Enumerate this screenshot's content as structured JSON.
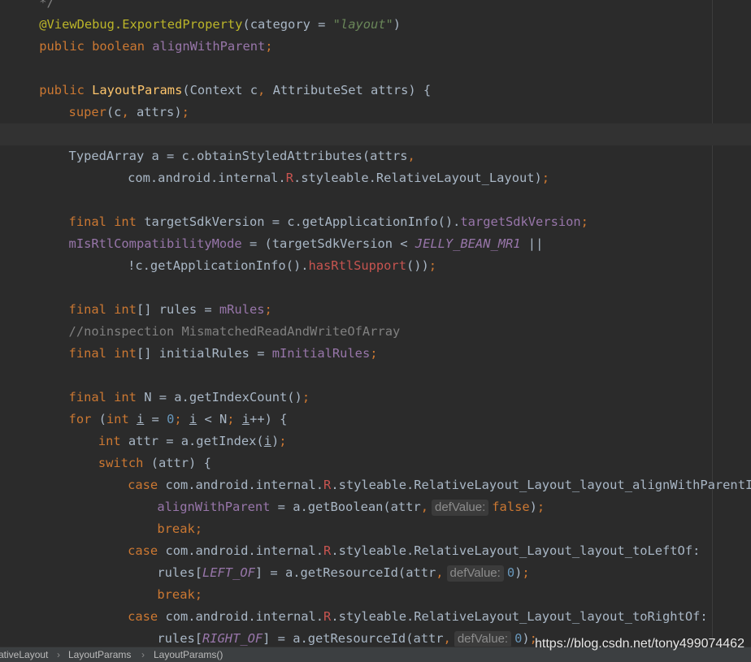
{
  "editor": {
    "lines": [
      {
        "indent": 4,
        "tokens": [
          {
            "t": "*/",
            "c": "cmt"
          }
        ]
      },
      {
        "indent": 4,
        "tokens": [
          {
            "t": "@ViewDebug.ExportedProperty",
            "c": "ann"
          },
          {
            "t": "(category = ",
            "c": "plain"
          },
          {
            "t": "\"layout\"",
            "c": "str"
          },
          {
            "t": ")",
            "c": "plain"
          }
        ]
      },
      {
        "indent": 4,
        "tokens": [
          {
            "t": "public boolean ",
            "c": "kw"
          },
          {
            "t": "alignWithParent",
            "c": "field"
          },
          {
            "t": ";",
            "c": "kw"
          }
        ]
      },
      {
        "indent": 0,
        "tokens": []
      },
      {
        "indent": 4,
        "tokens": [
          {
            "t": "public ",
            "c": "kw"
          },
          {
            "t": "LayoutParams",
            "c": "method"
          },
          {
            "t": "(Context c",
            "c": "plain"
          },
          {
            "t": ", ",
            "c": "kw"
          },
          {
            "t": "AttributeSet attrs) {",
            "c": "plain"
          }
        ]
      },
      {
        "indent": 8,
        "tokens": [
          {
            "t": "super",
            "c": "kw"
          },
          {
            "t": "(c",
            "c": "plain"
          },
          {
            "t": ", ",
            "c": "kw"
          },
          {
            "t": "attrs)",
            "c": "plain"
          },
          {
            "t": ";",
            "c": "kw"
          }
        ]
      },
      {
        "indent": 0,
        "tokens": [],
        "caret": true
      },
      {
        "indent": 8,
        "tokens": [
          {
            "t": "TypedArray a = c.obtainStyledAttributes(attrs",
            "c": "plain"
          },
          {
            "t": ",",
            "c": "kw"
          }
        ]
      },
      {
        "indent": 16,
        "tokens": [
          {
            "t": "com.android.internal.",
            "c": "plain"
          },
          {
            "t": "R",
            "c": "r"
          },
          {
            "t": ".styleable.RelativeLayout_Layout)",
            "c": "plain"
          },
          {
            "t": ";",
            "c": "kw"
          }
        ]
      },
      {
        "indent": 0,
        "tokens": []
      },
      {
        "indent": 8,
        "tokens": [
          {
            "t": "final int ",
            "c": "kw"
          },
          {
            "t": "targetSdkVersion = c.getApplicationInfo().",
            "c": "plain"
          },
          {
            "t": "targetSdkVersion",
            "c": "field"
          },
          {
            "t": ";",
            "c": "kw"
          }
        ]
      },
      {
        "indent": 8,
        "tokens": [
          {
            "t": "mIsRtlCompatibilityMode",
            "c": "field"
          },
          {
            "t": " = (targetSdkVersion < ",
            "c": "plain"
          },
          {
            "t": "JELLY_BEAN_MR1",
            "c": "const"
          },
          {
            "t": " ||",
            "c": "plain"
          }
        ]
      },
      {
        "indent": 16,
        "tokens": [
          {
            "t": "!c.getApplicationInfo().",
            "c": "plain"
          },
          {
            "t": "hasRtlSupport",
            "c": "r"
          },
          {
            "t": "())",
            "c": "plain"
          },
          {
            "t": ";",
            "c": "kw"
          }
        ]
      },
      {
        "indent": 0,
        "tokens": []
      },
      {
        "indent": 8,
        "tokens": [
          {
            "t": "final int",
            "c": "kw"
          },
          {
            "t": "[] rules = ",
            "c": "plain"
          },
          {
            "t": "mRules",
            "c": "field"
          },
          {
            "t": ";",
            "c": "kw"
          }
        ]
      },
      {
        "indent": 8,
        "tokens": [
          {
            "t": "//noinspection MismatchedReadAndWriteOfArray",
            "c": "cmt"
          }
        ]
      },
      {
        "indent": 8,
        "tokens": [
          {
            "t": "final int",
            "c": "kw"
          },
          {
            "t": "[] initialRules = ",
            "c": "plain"
          },
          {
            "t": "mInitialRules",
            "c": "field"
          },
          {
            "t": ";",
            "c": "kw"
          }
        ]
      },
      {
        "indent": 0,
        "tokens": []
      },
      {
        "indent": 8,
        "tokens": [
          {
            "t": "final int ",
            "c": "kw"
          },
          {
            "t": "N = a.getIndexCount()",
            "c": "plain"
          },
          {
            "t": ";",
            "c": "kw"
          }
        ]
      },
      {
        "indent": 8,
        "tokens": [
          {
            "t": "for ",
            "c": "kw"
          },
          {
            "t": "(",
            "c": "plain"
          },
          {
            "t": "int ",
            "c": "kw"
          },
          {
            "t": "i",
            "c": "u"
          },
          {
            "t": " = ",
            "c": "plain"
          },
          {
            "t": "0",
            "c": "num"
          },
          {
            "t": "; ",
            "c": "kw"
          },
          {
            "t": "i",
            "c": "u"
          },
          {
            "t": " < N",
            "c": "plain"
          },
          {
            "t": "; ",
            "c": "kw"
          },
          {
            "t": "i",
            "c": "u"
          },
          {
            "t": "++) {",
            "c": "plain"
          }
        ]
      },
      {
        "indent": 12,
        "tokens": [
          {
            "t": "int ",
            "c": "kw"
          },
          {
            "t": "attr = a.getIndex(",
            "c": "plain"
          },
          {
            "t": "i",
            "c": "u"
          },
          {
            "t": ")",
            "c": "plain"
          },
          {
            "t": ";",
            "c": "kw"
          }
        ]
      },
      {
        "indent": 12,
        "tokens": [
          {
            "t": "switch ",
            "c": "kw"
          },
          {
            "t": "(attr) {",
            "c": "plain"
          }
        ]
      },
      {
        "indent": 16,
        "tokens": [
          {
            "t": "case ",
            "c": "kw"
          },
          {
            "t": "com.android.internal.",
            "c": "plain"
          },
          {
            "t": "R",
            "c": "r"
          },
          {
            "t": ".styleable.RelativeLayout_Layout_layout_alignWithParentIfMissing:",
            "c": "plain"
          }
        ]
      },
      {
        "indent": 20,
        "tokens": [
          {
            "t": "alignWithParent",
            "c": "field"
          },
          {
            "t": " = a.getBoolean(attr",
            "c": "plain"
          },
          {
            "t": ",",
            "c": "kw"
          },
          {
            "t": "defValue:",
            "c": "hint"
          },
          {
            "t": "false",
            "c": "kw"
          },
          {
            "t": ")",
            "c": "plain"
          },
          {
            "t": ";",
            "c": "kw"
          }
        ]
      },
      {
        "indent": 20,
        "tokens": [
          {
            "t": "break;",
            "c": "kw"
          }
        ]
      },
      {
        "indent": 16,
        "tokens": [
          {
            "t": "case ",
            "c": "kw"
          },
          {
            "t": "com.android.internal.",
            "c": "plain"
          },
          {
            "t": "R",
            "c": "r"
          },
          {
            "t": ".styleable.RelativeLayout_Layout_layout_toLeftOf:",
            "c": "plain"
          }
        ]
      },
      {
        "indent": 20,
        "tokens": [
          {
            "t": "rules[",
            "c": "plain"
          },
          {
            "t": "LEFT_OF",
            "c": "const"
          },
          {
            "t": "] = a.getResourceId(attr",
            "c": "plain"
          },
          {
            "t": ",",
            "c": "kw"
          },
          {
            "t": "defValue:",
            "c": "hint"
          },
          {
            "t": "0",
            "c": "num"
          },
          {
            "t": ")",
            "c": "plain"
          },
          {
            "t": ";",
            "c": "kw"
          }
        ]
      },
      {
        "indent": 20,
        "tokens": [
          {
            "t": "break;",
            "c": "kw"
          }
        ]
      },
      {
        "indent": 16,
        "tokens": [
          {
            "t": "case ",
            "c": "kw"
          },
          {
            "t": "com.android.internal.",
            "c": "plain"
          },
          {
            "t": "R",
            "c": "r"
          },
          {
            "t": ".styleable.RelativeLayout_Layout_layout_toRightOf:",
            "c": "plain"
          }
        ]
      },
      {
        "indent": 20,
        "tokens": [
          {
            "t": "rules[",
            "c": "plain"
          },
          {
            "t": "RIGHT_OF",
            "c": "const"
          },
          {
            "t": "] = a.getResourceId(attr",
            "c": "plain"
          },
          {
            "t": ",",
            "c": "kw"
          },
          {
            "t": "defValue:",
            "c": "hint"
          },
          {
            "t": "0",
            "c": "num"
          },
          {
            "t": ")",
            "c": "plain"
          },
          {
            "t": ";",
            "c": "kw"
          }
        ]
      }
    ]
  },
  "breadcrumb": {
    "items": [
      "ativeLayout",
      "LayoutParams",
      "LayoutParams()"
    ],
    "separator": "›"
  },
  "watermark": {
    "text": "https://blog.csdn.net/tony499074462"
  },
  "colors": {
    "background": "#2b2b2b",
    "keyword": "#cc7832",
    "annotation": "#bbb529",
    "string": "#6a8759",
    "number": "#6897bb",
    "field": "#9876aa",
    "method": "#ffc66d",
    "text": "#a9b7c6",
    "comment": "#808080",
    "unresolved": "#c75450"
  }
}
